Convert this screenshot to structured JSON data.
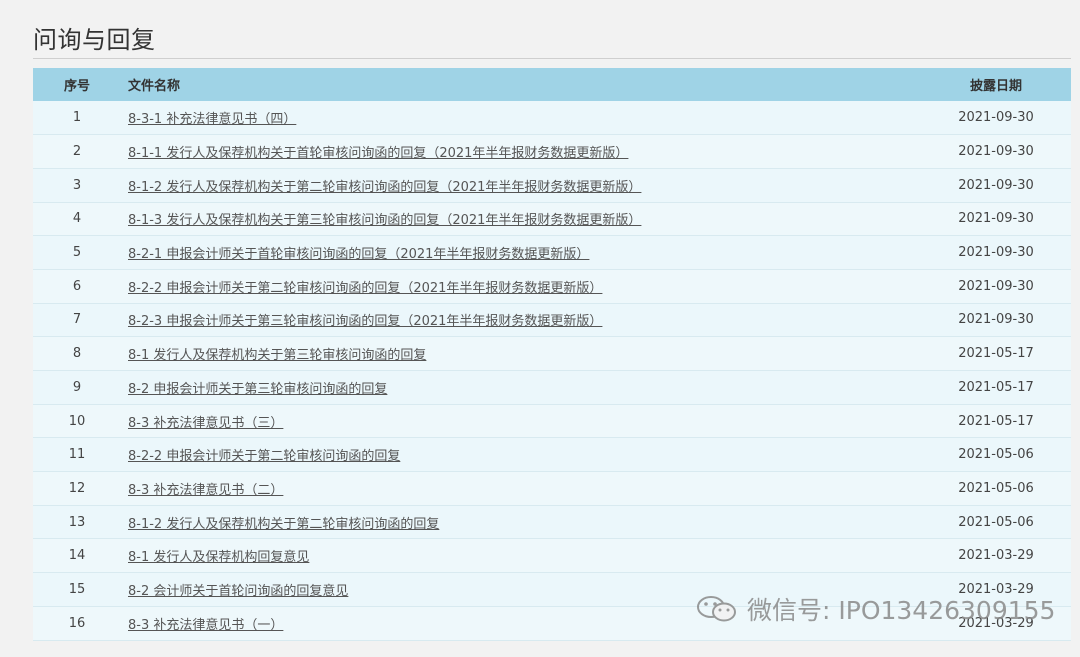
{
  "section": {
    "title": "问询与回复"
  },
  "table": {
    "headers": {
      "no": "序号",
      "name": "文件名称",
      "date": "披露日期"
    },
    "rows": [
      {
        "no": "1",
        "name": "8-3-1 补充法律意见书（四）",
        "date": "2021-09-30"
      },
      {
        "no": "2",
        "name": "8-1-1 发行人及保荐机构关于首轮审核问询函的回复（2021年半年报财务数据更新版）",
        "date": "2021-09-30"
      },
      {
        "no": "3",
        "name": "8-1-2 发行人及保荐机构关于第二轮审核问询函的回复（2021年半年报财务数据更新版）",
        "date": "2021-09-30"
      },
      {
        "no": "4",
        "name": "8-1-3 发行人及保荐机构关于第三轮审核问询函的回复（2021年半年报财务数据更新版）",
        "date": "2021-09-30"
      },
      {
        "no": "5",
        "name": "8-2-1 申报会计师关于首轮审核问询函的回复（2021年半年报财务数据更新版）",
        "date": "2021-09-30"
      },
      {
        "no": "6",
        "name": "8-2-2 申报会计师关于第二轮审核问询函的回复（2021年半年报财务数据更新版）",
        "date": "2021-09-30"
      },
      {
        "no": "7",
        "name": "8-2-3 申报会计师关于第三轮审核问询函的回复（2021年半年报财务数据更新版）",
        "date": "2021-09-30"
      },
      {
        "no": "8",
        "name": "8-1 发行人及保荐机构关于第三轮审核问询函的回复",
        "date": "2021-05-17"
      },
      {
        "no": "9",
        "name": "8-2 申报会计师关于第三轮审核问询函的回复",
        "date": "2021-05-17"
      },
      {
        "no": "10",
        "name": "8-3 补充法律意见书（三）",
        "date": "2021-05-17"
      },
      {
        "no": "11",
        "name": "8-2-2 申报会计师关于第二轮审核问询函的回复",
        "date": "2021-05-06"
      },
      {
        "no": "12",
        "name": "8-3 补充法律意见书（二）",
        "date": "2021-05-06"
      },
      {
        "no": "13",
        "name": "8-1-2 发行人及保荐机构关于第二轮审核问询函的回复",
        "date": "2021-05-06"
      },
      {
        "no": "14",
        "name": "8-1 发行人及保荐机构回复意见",
        "date": "2021-03-29"
      },
      {
        "no": "15",
        "name": "8-2 会计师关于首轮问询函的回复意见",
        "date": "2021-03-29"
      },
      {
        "no": "16",
        "name": "8-3 补充法律意见书（一）",
        "date": "2021-03-29"
      }
    ]
  },
  "watermark": {
    "text": "微信号: IPO13426309155",
    "icon": "wechat-icon"
  },
  "colors": {
    "header_bg": "#9fd3e6",
    "row_bg": "#ebf7fb",
    "page_bg": "#f2f2f2",
    "link": "#555555"
  }
}
